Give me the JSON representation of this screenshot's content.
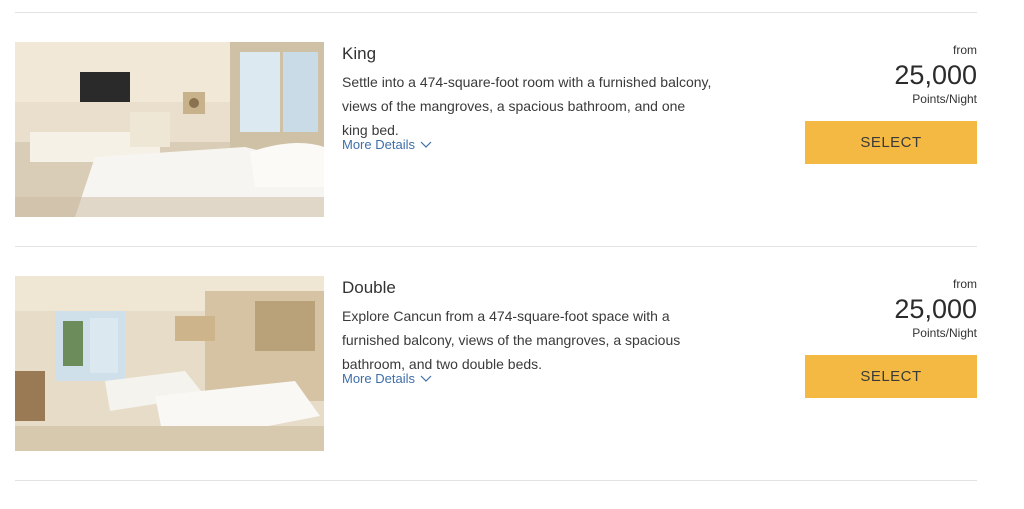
{
  "rooms": [
    {
      "name": "King",
      "description": "Settle into a 474-square-foot room with a furnished balcony, views of the mangroves, a spacious bathroom, and one king bed.",
      "more_details": "More Details",
      "from_label": "from",
      "price": "25,000",
      "unit": "Points/Night",
      "select_label": "SELECT"
    },
    {
      "name": "Double",
      "description": "Explore Cancun from a 474-square-foot space with a furnished balcony, views of the mangroves, a spacious bathroom, and two double beds.",
      "more_details": "More Details",
      "from_label": "from",
      "price": "25,000",
      "unit": "Points/Night",
      "select_label": "SELECT"
    }
  ],
  "colors": {
    "select_button": "#f4b942",
    "link": "#3f6fa8",
    "divider": "#e3e3e3"
  },
  "icons": {
    "more_details": "chevron-down-icon"
  }
}
